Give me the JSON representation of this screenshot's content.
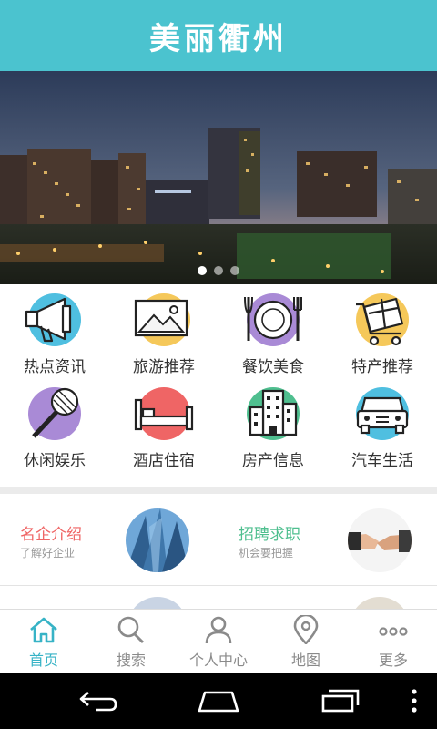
{
  "header": {
    "title": "美丽衢州"
  },
  "banner": {
    "slides": 3,
    "active_slide": 1
  },
  "categories": [
    {
      "label": "热点资讯",
      "icon": "megaphone-icon",
      "color": "#4fbfe0"
    },
    {
      "label": "旅游推荐",
      "icon": "picture-icon",
      "color": "#f5c85a"
    },
    {
      "label": "餐饮美食",
      "icon": "plate-cutlery-icon",
      "color": "#a98ad6"
    },
    {
      "label": "特产推荐",
      "icon": "gift-cart-icon",
      "color": "#f5c85a"
    },
    {
      "label": "休闲娱乐",
      "icon": "microphone-icon",
      "color": "#a98ad6"
    },
    {
      "label": "酒店住宿",
      "icon": "bed-icon",
      "color": "#ef6565"
    },
    {
      "label": "房产信息",
      "icon": "building-icon",
      "color": "#4fbf8f"
    },
    {
      "label": "汽车生活",
      "icon": "car-icon",
      "color": "#4fbfe0"
    }
  ],
  "promos": [
    {
      "title": "名企介绍",
      "subtitle": "了解好企业",
      "color": "#ef6565",
      "image": "skyscraper-photo"
    },
    {
      "title": "招聘求职",
      "subtitle": "机会要把握",
      "color": "#4fbf8f",
      "image": "handshake-photo"
    }
  ],
  "tabs": [
    {
      "label": "首页",
      "icon": "home-icon",
      "active": true
    },
    {
      "label": "搜索",
      "icon": "search-icon",
      "active": false
    },
    {
      "label": "个人中心",
      "icon": "user-icon",
      "active": false
    },
    {
      "label": "地图",
      "icon": "map-pin-icon",
      "active": false
    },
    {
      "label": "更多",
      "icon": "more-icon",
      "active": false
    }
  ],
  "colors": {
    "header": "#4bc3cf",
    "accent": "#37b3c6"
  }
}
